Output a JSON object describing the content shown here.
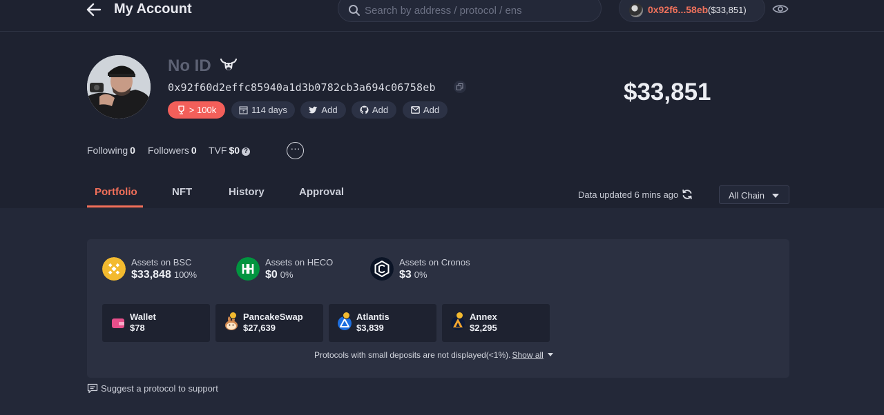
{
  "header": {
    "title": "My Account",
    "search_placeholder": "Search by address / protocol / ens",
    "wallet_address": "0x92f6...58eb",
    "wallet_balance": "($33,851)"
  },
  "profile": {
    "name": "No ID",
    "address": "0x92f60d2effc85940a1d3b0782cb3a694c06758eb",
    "score_badge": "> 100k",
    "age": "114 days",
    "twitter_label": "Add",
    "github_label": "Add",
    "email_label": "Add",
    "total_value": "$33,851"
  },
  "stats": {
    "following_label": "Following",
    "following_value": "0",
    "followers_label": "Followers",
    "followers_value": "0",
    "tvf_label": "TVF",
    "tvf_value": "$0"
  },
  "tabs": [
    "Portfolio",
    "NFT",
    "History",
    "Approval"
  ],
  "data_updated": "Data updated 6 mins ago",
  "chain_filter": "All Chain",
  "chains": [
    {
      "label": "Assets on BSC",
      "value": "$33,848",
      "percent": "100%",
      "color": "#f3ba2f"
    },
    {
      "label": "Assets on HECO",
      "value": "$0",
      "percent": "0%",
      "color": "#01943f"
    },
    {
      "label": "Assets on Cronos",
      "value": "$3",
      "percent": "0%",
      "color": "#0b1426"
    }
  ],
  "protocols": [
    {
      "name": "Wallet",
      "value": "$78"
    },
    {
      "name": "PancakeSwap",
      "value": "$27,639"
    },
    {
      "name": "Atlantis",
      "value": "$3,839"
    },
    {
      "name": "Annex",
      "value": "$2,295"
    }
  ],
  "footer_note": {
    "text": "Protocols with small deposits are not displayed(<1%).",
    "link": "Show all"
  },
  "suggest_link": "Suggest a protocol to support",
  "colors": {
    "background": "#1e2230",
    "panel": "#2b3041",
    "accent": "#f4705a"
  }
}
